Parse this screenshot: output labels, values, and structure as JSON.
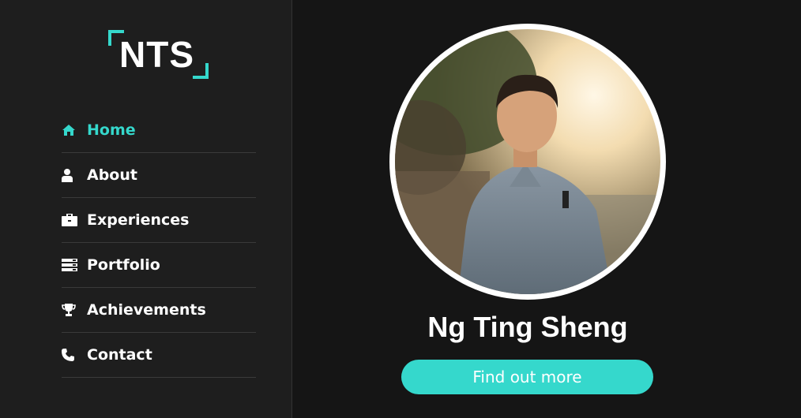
{
  "logo": {
    "text": "NTS"
  },
  "nav": {
    "items": [
      {
        "label": "Home",
        "icon": "home-icon",
        "active": true
      },
      {
        "label": "About",
        "icon": "user-icon",
        "active": false
      },
      {
        "label": "Experiences",
        "icon": "briefcase-icon",
        "active": false
      },
      {
        "label": "Portfolio",
        "icon": "server-icon",
        "active": false
      },
      {
        "label": "Achievements",
        "icon": "trophy-icon",
        "active": false
      },
      {
        "label": "Contact",
        "icon": "phone-icon",
        "active": false
      }
    ]
  },
  "profile": {
    "name": "Ng Ting Sheng",
    "cta_label": "Find out more"
  },
  "colors": {
    "accent": "#35d8cc",
    "sidebar_bg": "#1e1e1e",
    "main_bg": "#151515",
    "text": "#ffffff"
  }
}
